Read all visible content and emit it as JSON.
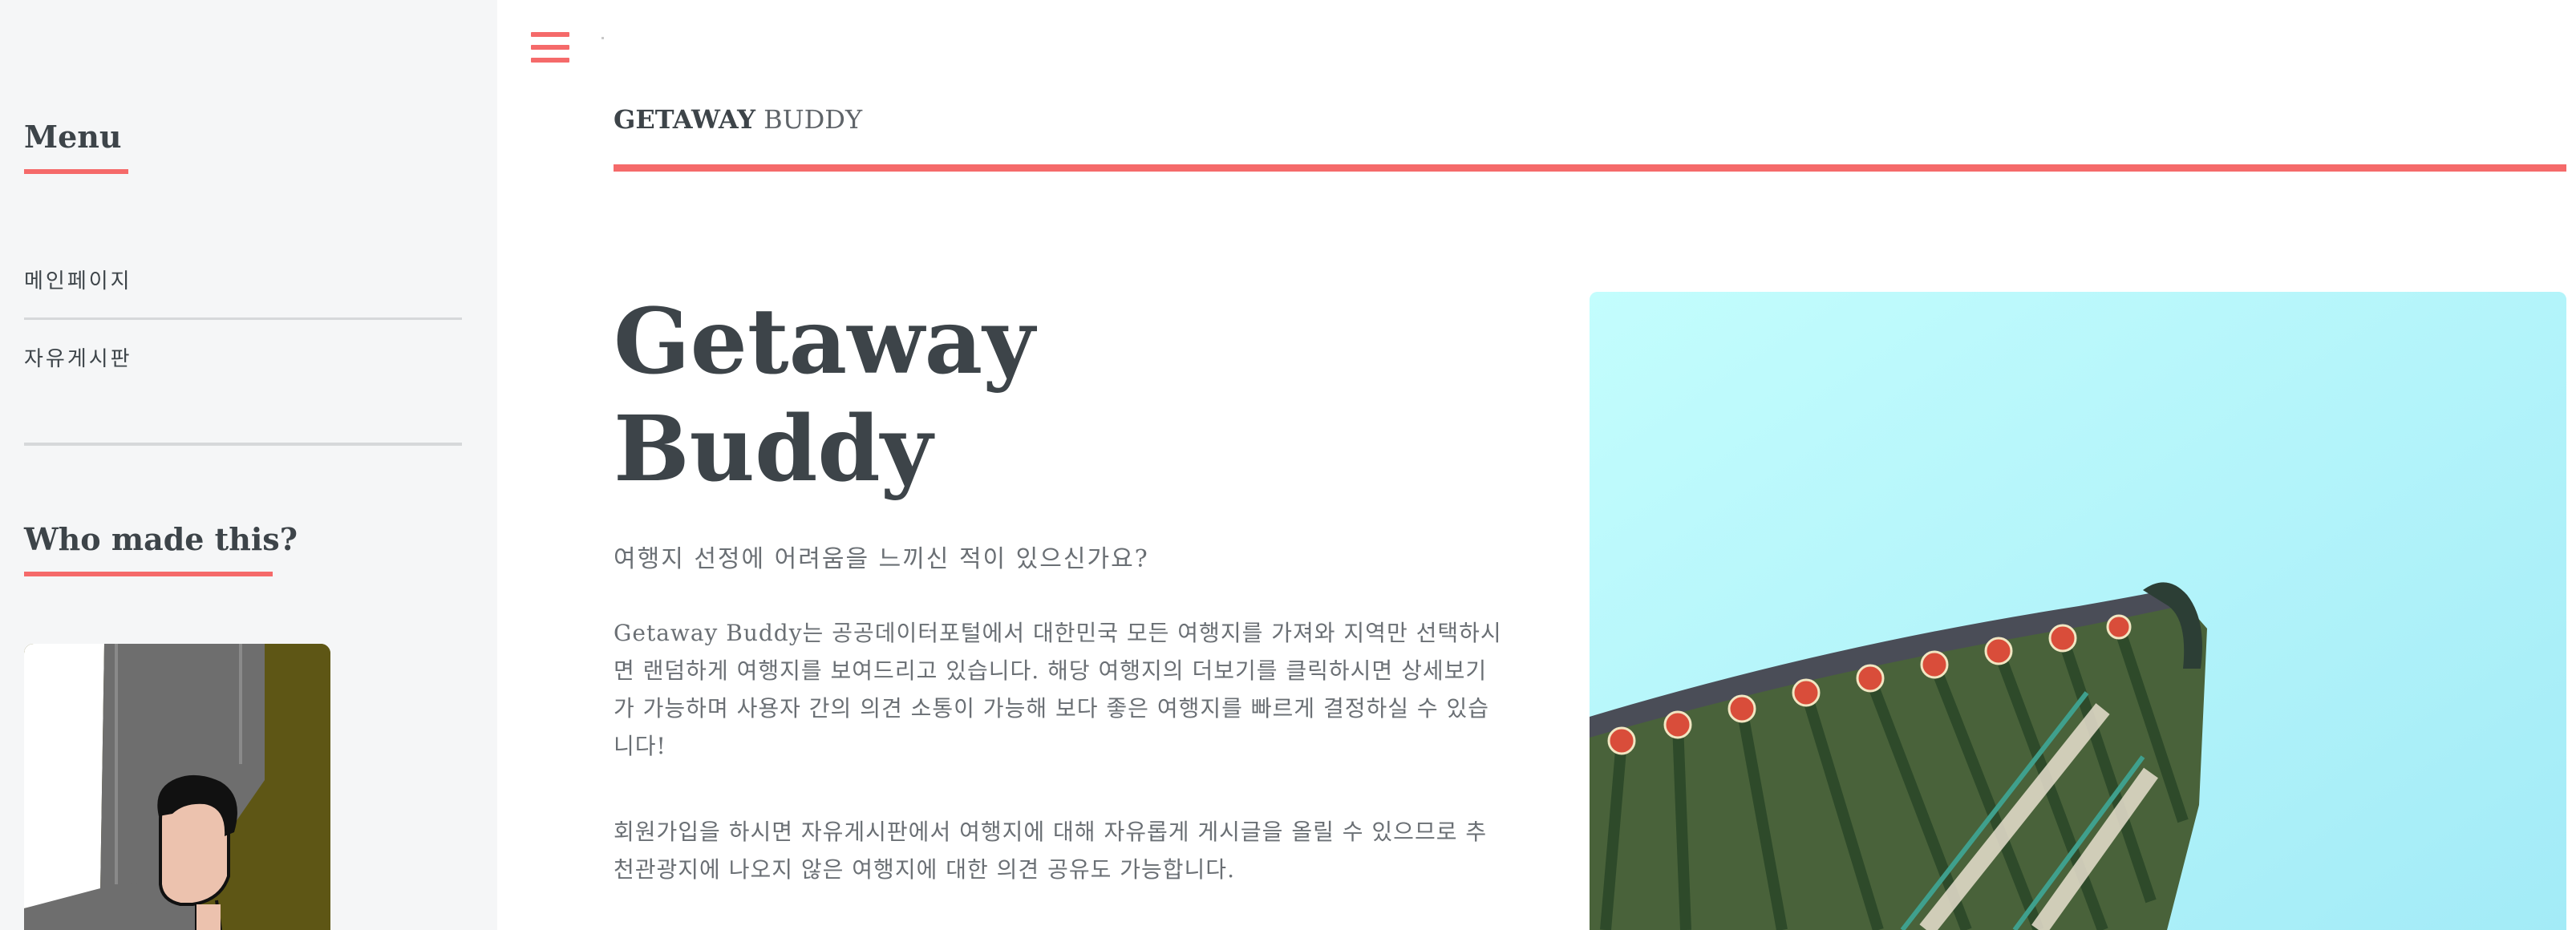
{
  "sidebar": {
    "menu_heading": "Menu",
    "menu_items": [
      {
        "label": "메인페이지"
      },
      {
        "label": "자유게시판"
      }
    ],
    "who_heading": "Who made this?"
  },
  "header": {
    "logo_bold": "GETAWAY",
    "logo_light": "BUDDY"
  },
  "banner": {
    "title_line1": "Getaway",
    "title_line2": "Buddy",
    "subtitle": "여행지 선정에 어려움을 느끼신 적이 있으신가요?",
    "paragraph1": "Getaway Buddy는 공공데이터포털에서 대한민국 모든 여행지를 가져와 지역만 선택하시면 랜덤하게 여행지를 보여드리고 있습니다. 해당 여행지의 더보기를 클릭하시면 상세보기가 가능하며 사용자 간의 의견 소통이 가능해 보다 좋은 여행지를 빠르게 결정하실 수 있습니다!",
    "paragraph2": "회원가입을 하시면 자유게시판에서 여행지에 대해 자유롭게 게시글을 올릴 수 있으므로 추천관광지에 나오지 않은 여행지에 대한 의견 공유도 가능합니다."
  },
  "icons": {
    "menu_toggle": "hamburger-icon"
  },
  "colors": {
    "accent": "#f56a6a",
    "text": "#3d4449",
    "sidebar_bg": "#f5f6f7",
    "sky": "#b4f5f8"
  }
}
